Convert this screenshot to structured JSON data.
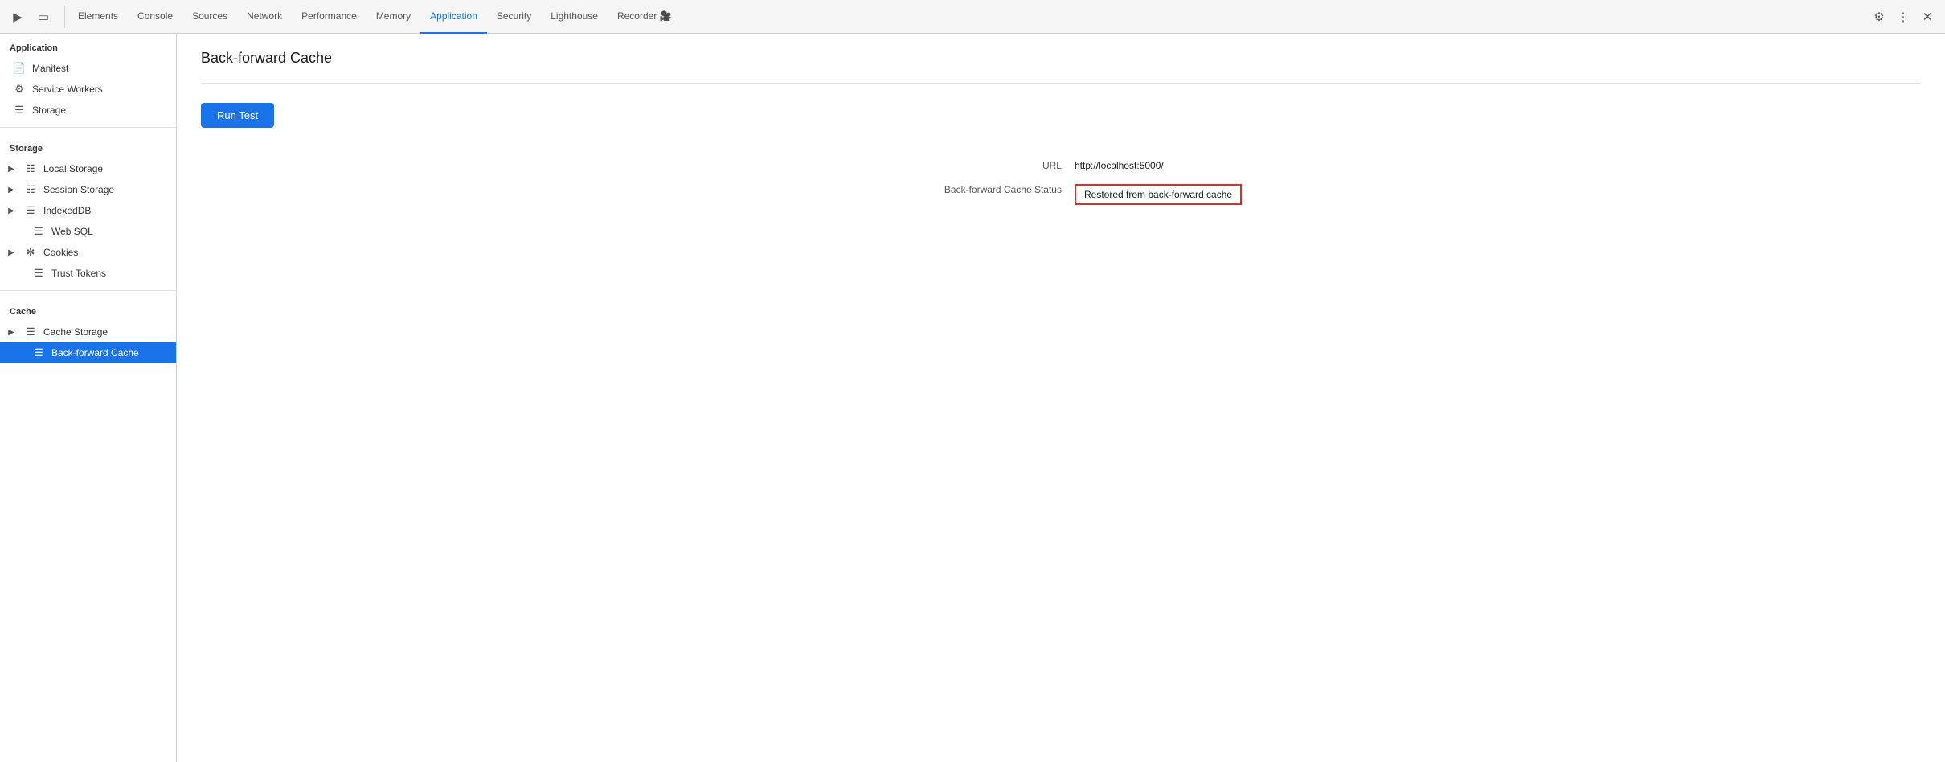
{
  "tabs": [
    {
      "id": "elements",
      "label": "Elements",
      "active": false
    },
    {
      "id": "console",
      "label": "Console",
      "active": false
    },
    {
      "id": "sources",
      "label": "Sources",
      "active": false
    },
    {
      "id": "network",
      "label": "Network",
      "active": false
    },
    {
      "id": "performance",
      "label": "Performance",
      "active": false
    },
    {
      "id": "memory",
      "label": "Memory",
      "active": false
    },
    {
      "id": "application",
      "label": "Application",
      "active": true
    },
    {
      "id": "security",
      "label": "Security",
      "active": false
    },
    {
      "id": "lighthouse",
      "label": "Lighthouse",
      "active": false
    },
    {
      "id": "recorder",
      "label": "Recorder 🎥",
      "active": false
    }
  ],
  "sidebar": {
    "application_title": "Application",
    "application_items": [
      {
        "id": "manifest",
        "label": "Manifest",
        "icon": "doc"
      },
      {
        "id": "service-workers",
        "label": "Service Workers",
        "icon": "gear"
      },
      {
        "id": "storage",
        "label": "Storage",
        "icon": "db"
      }
    ],
    "storage_title": "Storage",
    "storage_items": [
      {
        "id": "local-storage",
        "label": "Local Storage",
        "icon": "grid",
        "arrow": true
      },
      {
        "id": "session-storage",
        "label": "Session Storage",
        "icon": "grid",
        "arrow": true
      },
      {
        "id": "indexed-db",
        "label": "IndexedDB",
        "icon": "db",
        "arrow": true
      },
      {
        "id": "web-sql",
        "label": "Web SQL",
        "icon": "db",
        "arrow": false
      },
      {
        "id": "cookies",
        "label": "Cookies",
        "icon": "cookie",
        "arrow": true
      },
      {
        "id": "trust-tokens",
        "label": "Trust Tokens",
        "icon": "db",
        "arrow": false
      }
    ],
    "cache_title": "Cache",
    "cache_items": [
      {
        "id": "cache-storage",
        "label": "Cache Storage",
        "icon": "db",
        "arrow": true
      },
      {
        "id": "back-forward-cache",
        "label": "Back-forward Cache",
        "icon": "db",
        "active": true
      }
    ]
  },
  "content": {
    "page_title": "Back-forward Cache",
    "run_test_label": "Run Test",
    "url_label": "URL",
    "url_value": "http://localhost:5000/",
    "status_label": "Back-forward Cache Status",
    "status_value": "Restored from back-forward cache"
  }
}
